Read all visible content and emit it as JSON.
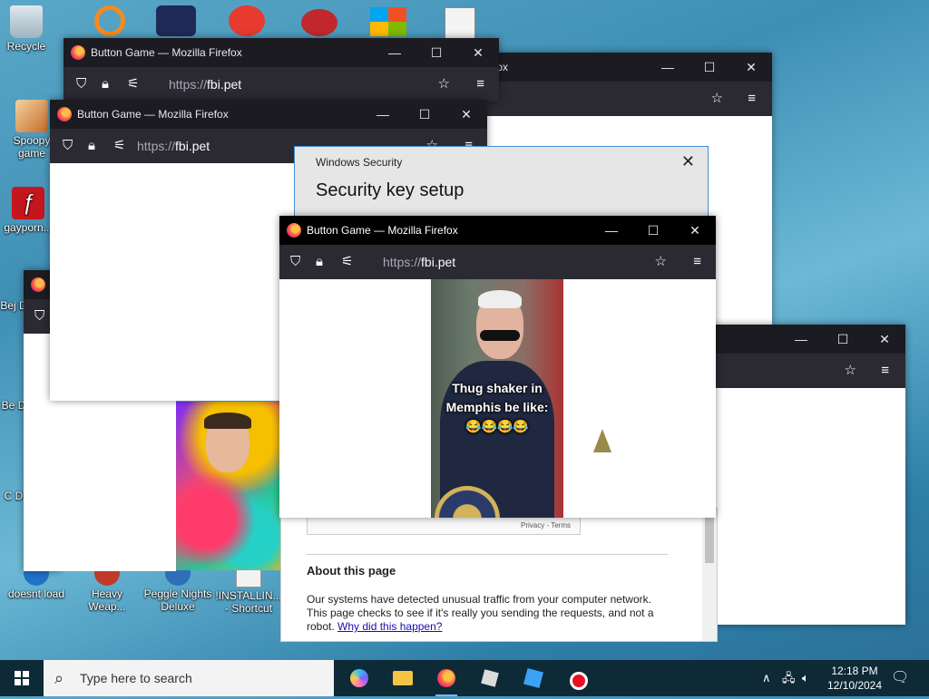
{
  "desktop": {
    "icons": [
      {
        "label": "Recycle"
      },
      {
        "label": "Spoopy game"
      },
      {
        "label": "gayporn..."
      },
      {
        "label": "Bej D"
      },
      {
        "label": "Be D"
      },
      {
        "label": "C D"
      },
      {
        "label": "doesnt load"
      },
      {
        "label": "Heavy Weap..."
      },
      {
        "label": "Peggle Nights Deluxe"
      },
      {
        "label": "!INSTALLIN... - Shortcut"
      }
    ]
  },
  "windows": {
    "title": "Button Game — Mozilla Firefox",
    "title_partial": "fox",
    "url_prefix": "https://",
    "url_host": "fbi.pet",
    "controls": {
      "minimize": "—",
      "maximize": "☐",
      "close": "✕"
    }
  },
  "security_dialog": {
    "header": "Windows Security",
    "title": "Security key setup",
    "close": "✕"
  },
  "meme": {
    "caption_line1": "Thug shaker in",
    "caption_line2": "Memphis be like:",
    "emojis": "😂😂😂😂"
  },
  "captcha_page": {
    "privacy_terms": "Privacy - Terms",
    "about_heading": "About this page",
    "body_text": "Our systems have detected unusual traffic from your computer network. This page checks to see if it's really you sending the requests, and not a robot.",
    "link_text": "Why did this happen?"
  },
  "taskbar": {
    "search_placeholder": "Type here to search",
    "time": "12:18 PM",
    "date": "12/10/2024",
    "tray_chevron": "∧"
  },
  "colors": {
    "ff_title": "#1c1b22",
    "ff_nav": "#2b2a33",
    "taskbar": "#0d2a36",
    "accent": "#3f8fd6"
  }
}
